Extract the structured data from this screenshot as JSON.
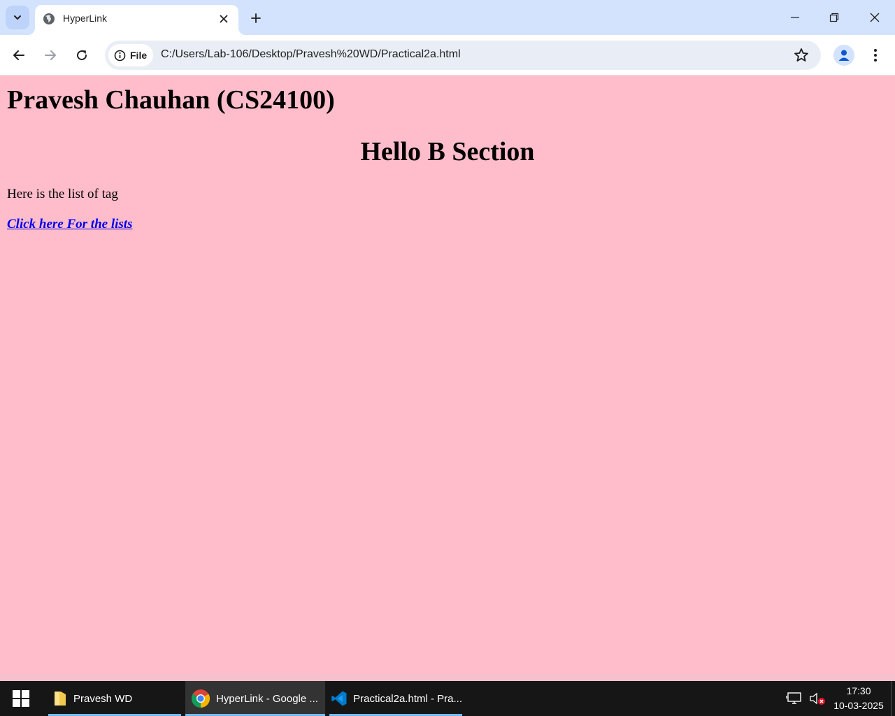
{
  "browser": {
    "tab": {
      "title": "HyperLink",
      "favicon": "globe-icon"
    },
    "address": {
      "chip_label": "File",
      "url": "C:/Users/Lab-106/Desktop/Pravesh%20WD/Practical2a.html"
    },
    "colors": {
      "tabbar_bg": "#d3e3fd",
      "omnibox_bg": "#e9eef6"
    }
  },
  "page": {
    "background": "#ffbccb",
    "heading_name": "Pravesh Chauhan (CS24100)",
    "heading_section": "Hello B Section",
    "intro_text": "Here is the list of tag",
    "link_text": "Click here For the lists",
    "link_color": "#0000ee"
  },
  "taskbar": {
    "apps": [
      {
        "label": "Pravesh WD",
        "icon": "folder-icon",
        "active": false
      },
      {
        "label": "HyperLink - Google ...",
        "icon": "chrome-icon",
        "active": true
      },
      {
        "label": "Practical2a.html - Pra...",
        "icon": "vscode-icon",
        "active": false
      }
    ],
    "clock": {
      "time": "17:30",
      "date": "10-03-2025"
    }
  }
}
